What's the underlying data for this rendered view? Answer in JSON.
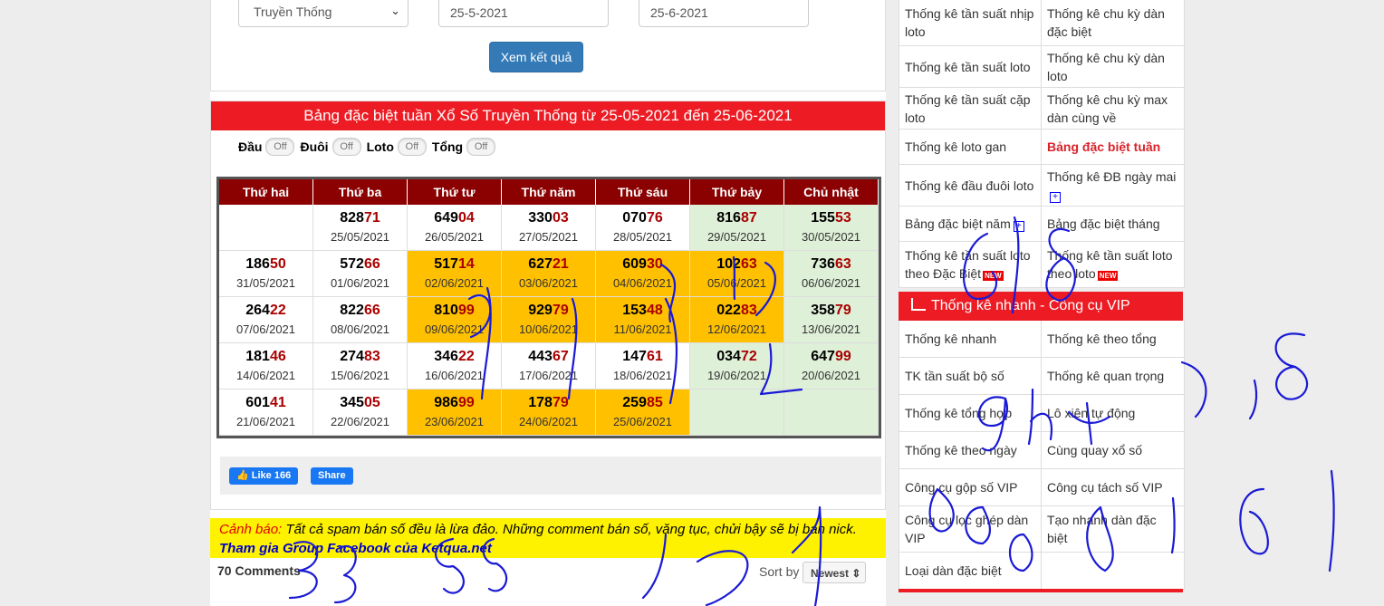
{
  "form": {
    "type_select": "Truyền Thống",
    "date_from": "25-5-2021",
    "date_to": "25-6-2021",
    "submit_label": "Xem kết quả"
  },
  "result": {
    "title": "Bảng đặc biệt tuần Xổ Số Truyền Thống từ 25-05-2021 đến 25-06-2021",
    "toggles": [
      {
        "label": "Đầu",
        "state": "Off"
      },
      {
        "label": "Đuôi",
        "state": "Off"
      },
      {
        "label": "Loto",
        "state": "Off"
      },
      {
        "label": "Tổng",
        "state": "Off"
      }
    ],
    "headers": [
      "Thứ hai",
      "Thứ ba",
      "Thứ tư",
      "Thứ năm",
      "Thứ sáu",
      "Thứ bảy",
      "Chủ nhật"
    ],
    "rows": [
      [
        {
          "head": "",
          "tail": "",
          "date": "",
          "bg": "w"
        },
        {
          "head": "828",
          "tail": "71",
          "date": "25/05/2021",
          "bg": "w"
        },
        {
          "head": "649",
          "tail": "04",
          "date": "26/05/2021",
          "bg": "w"
        },
        {
          "head": "330",
          "tail": "03",
          "date": "27/05/2021",
          "bg": "w"
        },
        {
          "head": "070",
          "tail": "76",
          "date": "28/05/2021",
          "bg": "w"
        },
        {
          "head": "816",
          "tail": "87",
          "date": "29/05/2021",
          "bg": "g"
        },
        {
          "head": "155",
          "tail": "53",
          "date": "30/05/2021",
          "bg": "g"
        }
      ],
      [
        {
          "head": "186",
          "tail": "50",
          "date": "31/05/2021",
          "bg": "w"
        },
        {
          "head": "572",
          "tail": "66",
          "date": "01/06/2021",
          "bg": "w"
        },
        {
          "head": "517",
          "tail": "14",
          "date": "02/06/2021",
          "bg": "o"
        },
        {
          "head": "627",
          "tail": "21",
          "date": "03/06/2021",
          "bg": "o"
        },
        {
          "head": "609",
          "tail": "30",
          "date": "04/06/2021",
          "bg": "o"
        },
        {
          "head": "102",
          "tail": "63",
          "date": "05/06/2021",
          "bg": "o"
        },
        {
          "head": "736",
          "tail": "63",
          "date": "06/06/2021",
          "bg": "g"
        }
      ],
      [
        {
          "head": "264",
          "tail": "22",
          "date": "07/06/2021",
          "bg": "w"
        },
        {
          "head": "822",
          "tail": "66",
          "date": "08/06/2021",
          "bg": "w"
        },
        {
          "head": "810",
          "tail": "99",
          "date": "09/06/2021",
          "bg": "o"
        },
        {
          "head": "929",
          "tail": "79",
          "date": "10/06/2021",
          "bg": "o"
        },
        {
          "head": "153",
          "tail": "48",
          "date": "11/06/2021",
          "bg": "o"
        },
        {
          "head": "022",
          "tail": "83",
          "date": "12/06/2021",
          "bg": "o"
        },
        {
          "head": "358",
          "tail": "79",
          "date": "13/06/2021",
          "bg": "g"
        }
      ],
      [
        {
          "head": "181",
          "tail": "46",
          "date": "14/06/2021",
          "bg": "w"
        },
        {
          "head": "274",
          "tail": "83",
          "date": "15/06/2021",
          "bg": "w"
        },
        {
          "head": "346",
          "tail": "22",
          "date": "16/06/2021",
          "bg": "w"
        },
        {
          "head": "443",
          "tail": "67",
          "date": "17/06/2021",
          "bg": "w"
        },
        {
          "head": "147",
          "tail": "61",
          "date": "18/06/2021",
          "bg": "w"
        },
        {
          "head": "034",
          "tail": "72",
          "date": "19/06/2021",
          "bg": "g"
        },
        {
          "head": "647",
          "tail": "99",
          "date": "20/06/2021",
          "bg": "g"
        }
      ],
      [
        {
          "head": "601",
          "tail": "41",
          "date": "21/06/2021",
          "bg": "w"
        },
        {
          "head": "345",
          "tail": "05",
          "date": "22/06/2021",
          "bg": "w"
        },
        {
          "head": "986",
          "tail": "99",
          "date": "23/06/2021",
          "bg": "o"
        },
        {
          "head": "178",
          "tail": "79",
          "date": "24/06/2021",
          "bg": "o"
        },
        {
          "head": "259",
          "tail": "85",
          "date": "25/06/2021",
          "bg": "o"
        },
        {
          "head": "",
          "tail": "",
          "date": "",
          "bg": "g"
        },
        {
          "head": "",
          "tail": "",
          "date": "",
          "bg": "g"
        }
      ]
    ],
    "like_label": "Like 166",
    "share_label": "Share"
  },
  "warning": {
    "prefix": "Cảnh báo:",
    "text": " Tất cả spam bán số đều là lừa đảo. Những comment bán số, văng tục, chửi bậy sẽ bị ban nick.",
    "group_link": "Tham gia Group Facebook của Ketqua.net"
  },
  "comments": {
    "count_label": "70 Comments",
    "sort_label": "Sort by",
    "sort_value": "Newest"
  },
  "sidebar": {
    "links_top": [
      [
        {
          "text": "Thống kê tần suất nhịp loto"
        },
        {
          "text": "Thống kê chu kỳ dàn đặc biệt"
        }
      ],
      [
        {
          "text": "Thống kê tần suất loto"
        },
        {
          "text": "Thống kê chu kỳ dàn loto"
        }
      ],
      [
        {
          "text": "Thống kê tần suất cặp loto"
        },
        {
          "text": "Thống kê chu kỳ max dàn cùng về"
        }
      ],
      [
        {
          "text": "Thống kê loto gan"
        },
        {
          "text": "Bảng đặc biệt tuần",
          "active": true
        }
      ],
      [
        {
          "text": "Thống kê đầu đuôi loto"
        },
        {
          "text": "Thống kê ĐB ngày mai",
          "plus": true
        }
      ],
      [
        {
          "text": "Bảng đặc biệt năm",
          "plus": true
        },
        {
          "text": "Bảng đặc biệt tháng"
        }
      ],
      [
        {
          "text": "Thống kê tần suất loto theo Đặc Biệt",
          "new": true
        },
        {
          "text": "Thống kê tần suất loto theo loto",
          "new": true
        }
      ]
    ],
    "new_badge": "NEW",
    "plus_glyph": "+",
    "section_title": "Thống kê nhanh - Công cụ VIP",
    "links_vip": [
      [
        {
          "text": "Thống kê nhanh"
        },
        {
          "text": "Thống kê theo tổng"
        }
      ],
      [
        {
          "text": "TK tần suất bộ số"
        },
        {
          "text": "Thống kê quan trọng"
        }
      ],
      [
        {
          "text": "Thống kê tổng hợp"
        },
        {
          "text": "Lô xiên tự động"
        }
      ],
      [
        {
          "text": "Thống kê theo ngày"
        },
        {
          "text": "Cùng quay xổ số"
        }
      ],
      [
        {
          "text": "Công cụ gộp số VIP"
        },
        {
          "text": "Công cụ tách số VIP"
        }
      ],
      [
        {
          "text": "Công cụ lọc ghép dàn VIP"
        },
        {
          "text": "Tạo nhanh dàn đặc biệt"
        }
      ],
      [
        {
          "text": "Loại dàn đặc biệt"
        },
        {
          "text": ""
        }
      ]
    ]
  },
  "colors": {
    "red_header": "#ed1c24",
    "table_header": "#8b0000",
    "highlight_orange": "#ffc000",
    "weekend_green": "#dff0d8",
    "ink_blue": "#1a1ad6"
  }
}
